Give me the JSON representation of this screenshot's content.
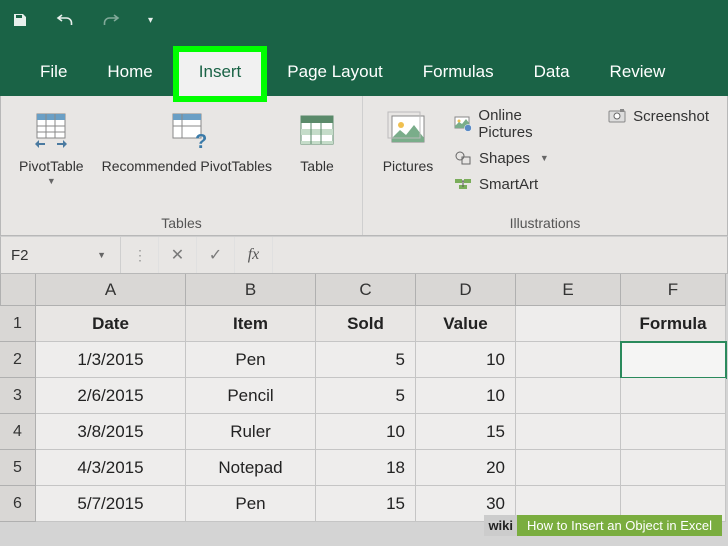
{
  "tabs": {
    "file": "File",
    "home": "Home",
    "insert": "Insert",
    "page_layout": "Page Layout",
    "formulas": "Formulas",
    "data": "Data",
    "review": "Review"
  },
  "ribbon": {
    "tables": {
      "label": "Tables",
      "pivot": "PivotTable",
      "recommended": "Recommended PivotTables",
      "table": "Table"
    },
    "illustrations": {
      "label": "Illustrations",
      "pictures": "Pictures",
      "online": "Online Pictures",
      "shapes": "Shapes",
      "smartart": "SmartArt",
      "screenshot": "Screenshot"
    }
  },
  "formulabar": {
    "namebox": "F2",
    "fx": "fx"
  },
  "columns": [
    "A",
    "B",
    "C",
    "D",
    "E",
    "F"
  ],
  "rows": [
    "1",
    "2",
    "3",
    "4",
    "5",
    "6"
  ],
  "headers": {
    "a": "Date",
    "b": "Item",
    "c": "Sold",
    "d": "Value",
    "f": "Formula"
  },
  "data_rows": [
    {
      "date": "1/3/2015",
      "item": "Pen",
      "sold": "5",
      "value": "10"
    },
    {
      "date": "2/6/2015",
      "item": "Pencil",
      "sold": "5",
      "value": "10"
    },
    {
      "date": "3/8/2015",
      "item": "Ruler",
      "sold": "10",
      "value": "15"
    },
    {
      "date": "4/3/2015",
      "item": "Notepad",
      "sold": "18",
      "value": "20"
    },
    {
      "date": "5/7/2015",
      "item": "Pen",
      "sold": "15",
      "value": "30"
    }
  ],
  "watermark": {
    "wiki": "wiki",
    "text": "How to Insert an Object in Excel"
  }
}
